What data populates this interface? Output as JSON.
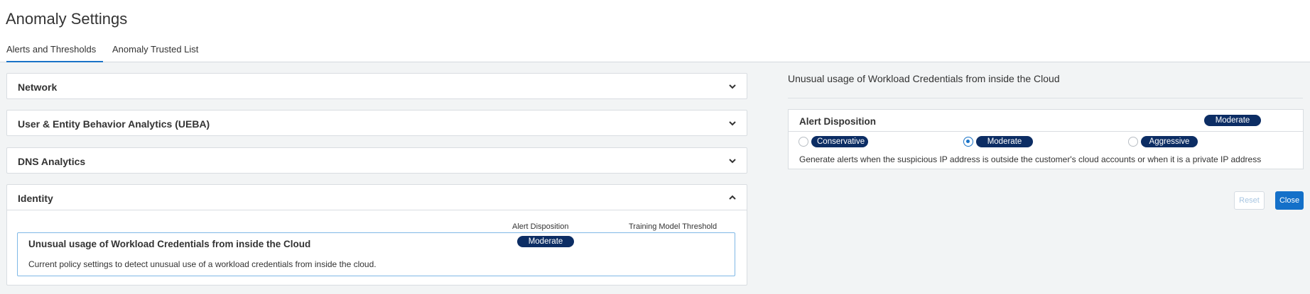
{
  "page": {
    "title": "Anomaly Settings"
  },
  "tabs": [
    {
      "label": "Alerts and Thresholds",
      "active": true
    },
    {
      "label": "Anomaly Trusted List",
      "active": false
    }
  ],
  "panels": [
    {
      "title": "Network",
      "expanded": false,
      "icon": "chevron-down-icon"
    },
    {
      "title": "User & Entity Behavior Analytics (UEBA)",
      "expanded": false,
      "icon": "chevron-down-icon"
    },
    {
      "title": "DNS Analytics",
      "expanded": false,
      "icon": "chevron-down-icon"
    },
    {
      "title": "Identity",
      "expanded": true,
      "icon": "chevron-up-icon"
    }
  ],
  "identity": {
    "columns": {
      "alert_disposition": "Alert Disposition",
      "training_threshold": "Training Model Threshold"
    },
    "policy": {
      "title": "Unusual usage of Workload Credentials from inside the Cloud",
      "description": "Current policy settings to detect unusual use of a workload credentials from inside the cloud.",
      "disposition": "Moderate"
    }
  },
  "detail": {
    "title": "Unusual usage of Workload Credentials from inside the Cloud",
    "disposition_card": {
      "title": "Alert Disposition",
      "current": "Moderate",
      "options": [
        {
          "label": "Conservative",
          "selected": false
        },
        {
          "label": "Moderate",
          "selected": true
        },
        {
          "label": "Aggressive",
          "selected": false
        }
      ],
      "description": "Generate alerts when the suspicious IP address is outside the customer's cloud accounts or when it is a private IP address"
    },
    "buttons": {
      "reset": "Reset",
      "close": "Close"
    }
  },
  "colors": {
    "accent": "#1a73c7",
    "badge": "#0c2d64",
    "content_bg": "#f2f4f5",
    "close_button": "#1470c9"
  }
}
